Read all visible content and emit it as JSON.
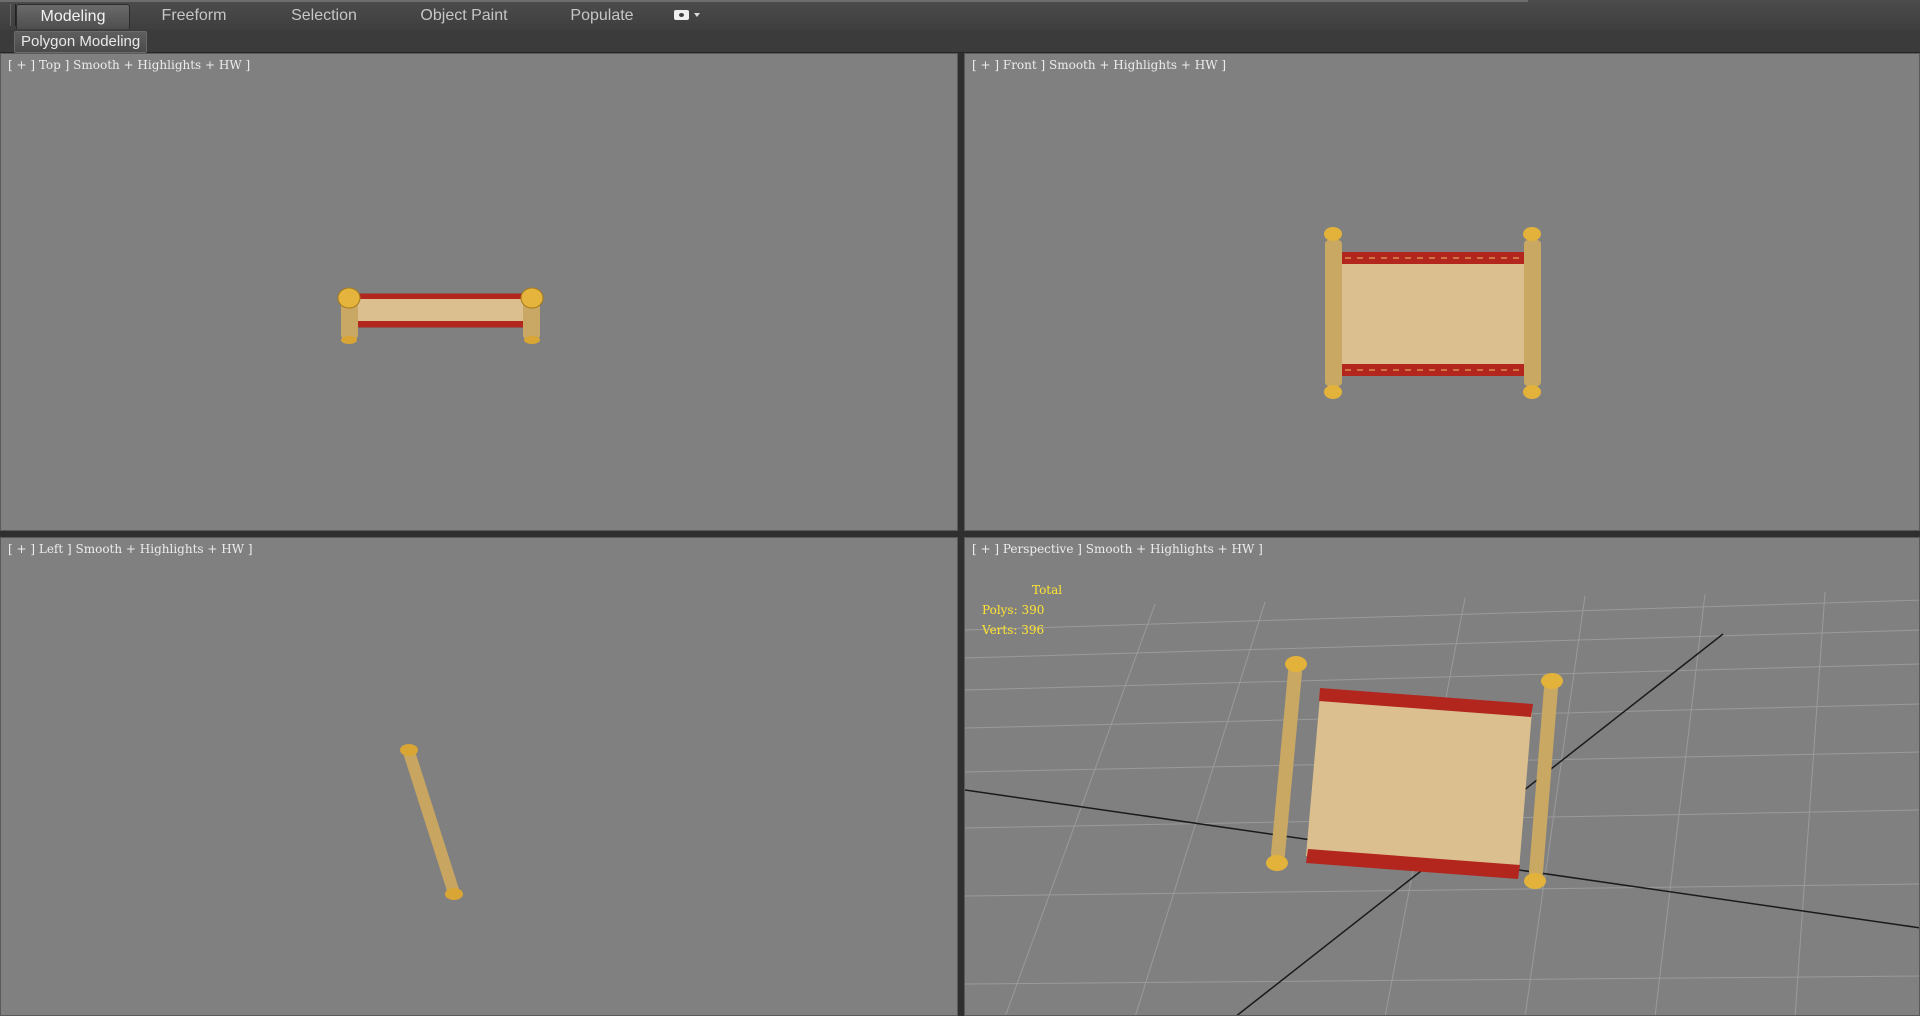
{
  "ribbon": {
    "tabs": [
      {
        "label": "Modeling",
        "active": true
      },
      {
        "label": "Freeform",
        "active": false
      },
      {
        "label": "Selection",
        "active": false
      },
      {
        "label": "Object Paint",
        "active": false
      },
      {
        "label": "Populate",
        "active": false
      }
    ],
    "options_icon": "camera-icon"
  },
  "subribbon": {
    "panel_label": "Polygon Modeling"
  },
  "viewports": {
    "top": {
      "label": "[ + ] Top ] Smooth + Highlights + HW ]"
    },
    "front": {
      "label": "[ + ] Front ] Smooth + Highlights + HW ]"
    },
    "left": {
      "label": "[ + ] Left ] Smooth + Highlights + HW ]"
    },
    "persp": {
      "label": "[ + ] Perspective ] Smooth + Highlights + HW ]"
    }
  },
  "stats": {
    "total_label": "Total",
    "polys": "Polys: 390",
    "verts": "Verts: 396"
  },
  "colors": {
    "viewport_bg": "#808080",
    "parchment": "#dbbf8e",
    "border_red": "#b2261e",
    "gold": "#d4a437",
    "stats_text": "#ffe433"
  }
}
